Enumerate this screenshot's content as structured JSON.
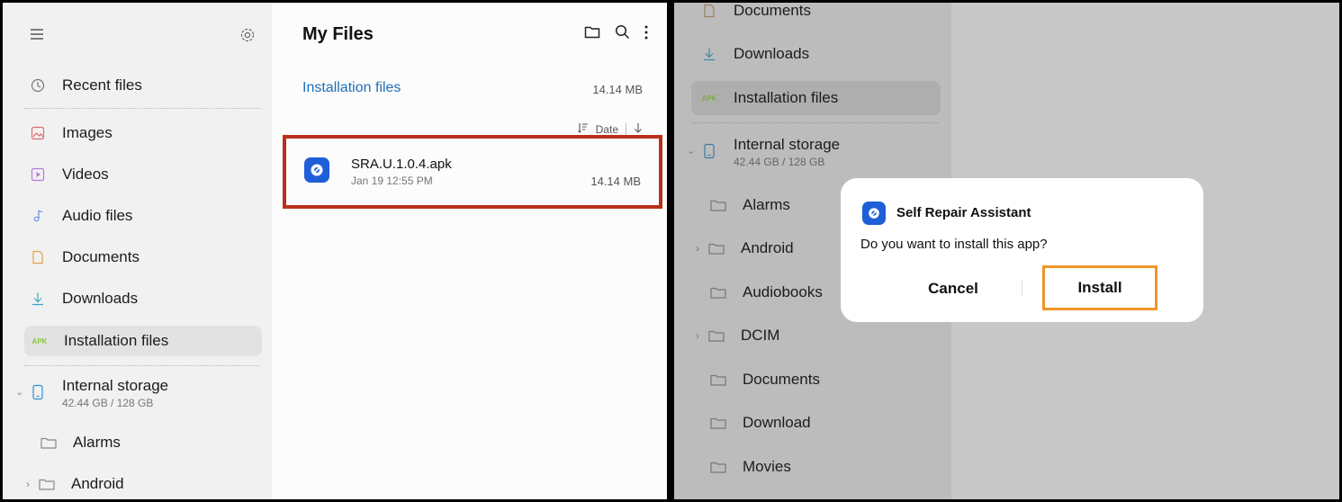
{
  "left_screen": {
    "sidebar": {
      "items": [
        {
          "label": "Recent files",
          "icon": "clock-icon"
        },
        {
          "label": "Images",
          "icon": "image-icon"
        },
        {
          "label": "Videos",
          "icon": "video-icon"
        },
        {
          "label": "Audio files",
          "icon": "music-note-icon"
        },
        {
          "label": "Documents",
          "icon": "document-icon"
        },
        {
          "label": "Downloads",
          "icon": "download-icon"
        },
        {
          "label": "Installation files",
          "icon": "apk-icon",
          "badge": "APK"
        },
        {
          "label": "Internal storage",
          "sub": "42.44 GB / 128 GB",
          "icon": "phone-icon"
        },
        {
          "label": "Alarms",
          "icon": "folder-icon"
        },
        {
          "label": "Android",
          "icon": "folder-icon"
        }
      ]
    },
    "main": {
      "title": "My Files",
      "breadcrumb": "Installation files",
      "total_size": "14.14 MB",
      "sort_label": "Date",
      "file": {
        "name": "SRA.U.1.0.4.apk",
        "date": "Jan 19 12:55 PM",
        "size": "14.14 MB"
      }
    },
    "colors": {
      "highlight_box": "#b8301b",
      "link": "#1e6fb8",
      "apk_badge": "#8cc63f"
    }
  },
  "right_screen": {
    "sidebar": {
      "partial_item": "Documents",
      "downloads": "Downloads",
      "installation_files": "Installation files",
      "badge": "APK",
      "storage_label": "Internal storage",
      "storage_sub": "42.44 GB / 128 GB",
      "folders": [
        "Alarms",
        "Android",
        "Audiobooks",
        "DCIM",
        "Documents",
        "Download",
        "Movies"
      ]
    },
    "dialog": {
      "app_name": "Self Repair Assistant",
      "message": "Do you want to install this app?",
      "cancel_label": "Cancel",
      "install_label": "Install"
    },
    "colors": {
      "install_highlight": "#f0962a",
      "app_icon": "#1e5fd8"
    }
  }
}
